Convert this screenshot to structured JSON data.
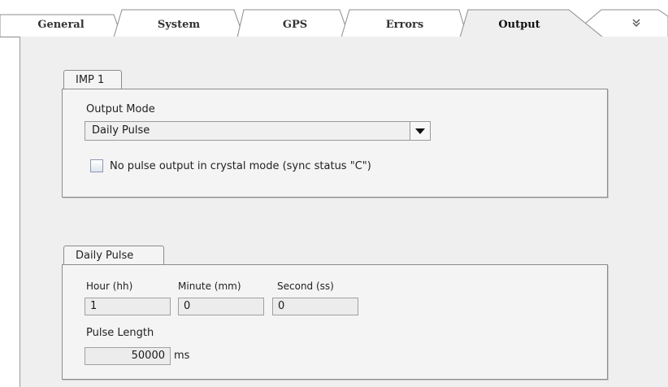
{
  "tabs": [
    {
      "label": "General",
      "active": false
    },
    {
      "label": "System",
      "active": false
    },
    {
      "label": "GPS",
      "active": false
    },
    {
      "label": "Errors",
      "active": false
    },
    {
      "label": "Output",
      "active": true
    }
  ],
  "overflow_icon": "double-chevron-down-icon",
  "imp_group": {
    "tab_label": "IMP 1",
    "output_mode_label": "Output Mode",
    "output_mode_value": "Daily Pulse",
    "checkbox_label": "No pulse output in crystal mode (sync status \"C\")",
    "checkbox_checked": false
  },
  "daily_pulse_group": {
    "tab_label": "Daily Pulse",
    "hour_label": "Hour (hh)",
    "hour_value": "1",
    "minute_label": "Minute (mm)",
    "minute_value": "0",
    "second_label": "Second (ss)",
    "second_value": "0",
    "pulse_length_label": "Pulse Length",
    "pulse_length_value": "50000",
    "pulse_length_unit": "ms"
  },
  "colors": {
    "panel_bg": "#efefef",
    "active_tab_bg": "#efefef",
    "inactive_tab_bg": "#ffffff",
    "border": "#8c8c8c"
  }
}
